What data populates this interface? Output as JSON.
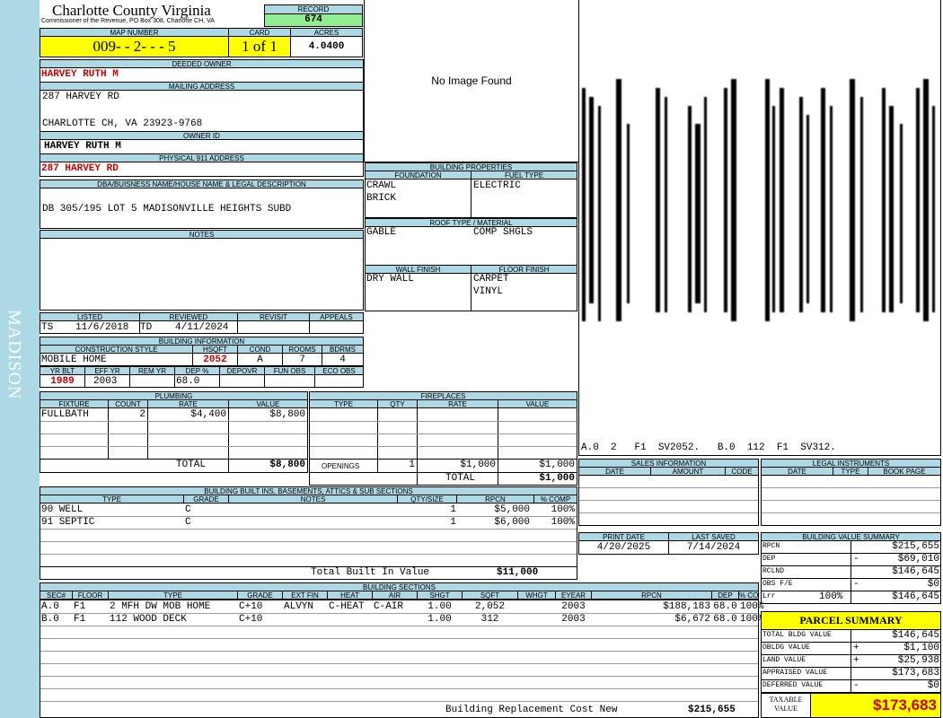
{
  "sidebar": {
    "text": "MADISON"
  },
  "header": {
    "county": "Charlotte County Virginia",
    "office": "Commissioner of the Revenue, PO Box 308, Charlotte CH, VA",
    "record_label": "RECORD",
    "record": "674",
    "map_label": "MAP NUMBER",
    "map_number": "009- - 2- - - 5",
    "card_label": "CARD",
    "card": "1 of 1",
    "acres_label": "ACRES",
    "acres": "4.0400"
  },
  "owner": {
    "deeded_label": "DEEDED OWNER",
    "deeded": "HARVEY RUTH M",
    "mailing_label": "MAILING ADDRESS",
    "mail1": "287 HARVEY RD",
    "mail2": "CHARLOTTE CH, VA 23923-9768",
    "ownerid_label": "OWNER ID",
    "ownerid": "HARVEY RUTH M",
    "phys_label": "PHYSICAL 911 ADDRESS",
    "phys": "287 HARVEY RD",
    "legal_label": "DBA/BUISNESS NAME/HOUSE NAME & LEGAL DESCRIPTION",
    "legal": "DB 305/195 LOT 5 MADISONVILLE HEIGHTS SUBD",
    "notes_label": "NOTES"
  },
  "image": {
    "text": "No Image Found"
  },
  "building_props": {
    "title": "BUILDING PROPERTIES",
    "foundation_label": "FOUNDATION",
    "fuel_label": "FUEL TYPE",
    "foundation1": "CRAWL",
    "foundation2": "BRICK",
    "fuel": "ELECTRIC",
    "roof_label": "ROOF TYPE / MATERIAL",
    "roof_type": "GABLE",
    "roof_mat": "COMP SHGLS",
    "wall_label": "WALL FINISH",
    "floor_label": "FLOOR FINISH",
    "wall": "DRY WALL",
    "floor1": "CARPET",
    "floor2": "VINYL"
  },
  "sketch": {
    "caption": "A.0  2   F1  SV2052.   B.0  112  F1  SV312."
  },
  "listing": {
    "listed_label": "LISTED",
    "reviewed_label": "REVIEWED",
    "revisit_label": "REVISIT",
    "appeals_label": "APPEALS",
    "listed_by": "TS",
    "listed_date": "11/6/2018",
    "reviewed_by": "TD",
    "reviewed_date": "4/11/2024"
  },
  "building_info": {
    "title": "BUILDING INFORMATION",
    "style_label": "CONSTRUCTION STYLE",
    "hsqft_label": "HSQFT",
    "cond_label": "COND",
    "rooms_label": "ROOMS",
    "bdrms_label": "BDRMS",
    "style": "MOBILE HOME",
    "hsqft": "2052",
    "cond": "A",
    "rooms": "7",
    "bdrms": "4",
    "yrblt_label": "YR BLT",
    "effyr_label": "EFF YR",
    "remyr_label": "REM YR",
    "dep_label": "DEP %",
    "depovr_label": "DEPOVR",
    "funobs_label": "FUN OBS",
    "ecoobs_label": "ECO OBS",
    "yrblt": "1989",
    "effyr": "2003",
    "dep": "68.0"
  },
  "plumbing": {
    "title": "PLUMBING",
    "h_fixture": "FIXTURE",
    "h_count": "COUNT",
    "h_rate": "RATE",
    "h_value": "VALUE",
    "fixture": "FULLBATH",
    "count": "2",
    "rate": "$4,400",
    "value": "$8,800",
    "total_label": "TOTAL",
    "total": "$8,800"
  },
  "fireplaces": {
    "title": "FIREPLACES",
    "h_type": "TYPE",
    "h_qty": "QTY",
    "h_rate": "RATE",
    "h_value": "VALUE",
    "openings_label": "OPENINGS",
    "qty": "1",
    "rate": "$1,000",
    "value": "$1,000",
    "total_label": "TOTAL",
    "total": "$1,000"
  },
  "builtins": {
    "title": "BUILDING BUILT INS, BASEMENTS, ATTICS & SUB SECTIONS",
    "h_type": "TYPE",
    "h_grade": "GRADE",
    "h_notes": "NOTES",
    "h_qty": "QTY/SIZE",
    "h_rpcn": "RPCN",
    "h_comp": "% COMP",
    "rows": [
      {
        "type": "90 WELL",
        "grade": "C",
        "qty": "1",
        "rpcn": "$5,000",
        "comp": "100%"
      },
      {
        "type": "91 SEPTIC",
        "grade": "C",
        "qty": "1",
        "rpcn": "$6,000",
        "comp": "100%"
      }
    ],
    "total_label": "Total Built In Value",
    "total": "$11,000"
  },
  "sales": {
    "title": "SALES INFORMATION",
    "h_date": "DATE",
    "h_amount": "AMOUNT",
    "h_code": "CODE"
  },
  "legal_inst": {
    "title": "LEGAL INSTRUMENTS",
    "h_date": "DATE",
    "h_type": "TYPE",
    "h_book": "BOOK PAGE"
  },
  "dates": {
    "print_label": "PRINT DATE",
    "saved_label": "LAST SAVED",
    "print": "4/20/2025",
    "saved": "7/14/2024"
  },
  "value_summary": {
    "title": "BUILDING VALUE SUMMARY",
    "rows": [
      {
        "label": "RPCN",
        "pct": "",
        "sign": "",
        "value": "$215,655"
      },
      {
        "label": "DEP",
        "pct": "",
        "sign": "-",
        "value": "$69,010"
      },
      {
        "label": "RCLND",
        "pct": "",
        "sign": "",
        "value": "$146,645"
      },
      {
        "label": "OBS F/E",
        "pct": "",
        "sign": "-",
        "value": "$0"
      },
      {
        "label": "Lrr",
        "pct": "100%",
        "sign": "",
        "value": "$146,645"
      }
    ]
  },
  "sections": {
    "title": "BUILDING SECTIONS",
    "headers": [
      "SEC#",
      "FLOOR",
      "TYPE",
      "GRADE",
      "EXT FIN",
      "HEAT",
      "AIR",
      "SHGT",
      "SQFT",
      "WHGT",
      "EYEAR",
      "RPCN",
      "DEP",
      "% COMP"
    ],
    "rows": [
      {
        "sec": "A.0",
        "floor": "F1",
        "type": "2 MFH DW MOB HOME",
        "grade": "C+10",
        "ext": "ALVYN",
        "heat": "C-HEAT",
        "air": "C-AIR",
        "shgt": "1.00",
        "sqft": "2,052",
        "whgt": "",
        "eyear": "2003",
        "rpcn": "$188,183",
        "dep": "68.0",
        "comp": "100%"
      },
      {
        "sec": "B.0",
        "floor": "F1",
        "type": "112 WOOD DECK",
        "grade": "C+10",
        "ext": "",
        "heat": "",
        "air": "",
        "shgt": "1.00",
        "sqft": "312",
        "whgt": "",
        "eyear": "2003",
        "rpcn": "$6,672",
        "dep": "68.0",
        "comp": "100%"
      }
    ],
    "replacement_label": "Building Replacement Cost New",
    "replacement": "$215,655"
  },
  "parcel": {
    "title": "PARCEL SUMMARY",
    "rows": [
      {
        "label": "TOTAL BLDG VALUE",
        "sign": "",
        "value": "$146,645"
      },
      {
        "label": "OBLDG VALUE",
        "sign": "+",
        "value": "$1,100"
      },
      {
        "label": "LAND VALUE",
        "sign": "+",
        "value": "$25,938"
      },
      {
        "label": "APPRAISED VALUE",
        "sign": "",
        "value": "$173,683"
      },
      {
        "label": "DEFERRED VALUE",
        "sign": "-",
        "value": "$0"
      }
    ],
    "taxable_label1": "TAXABLE",
    "taxable_label2": "VALUE",
    "taxable": "$173,683"
  },
  "colors": {
    "header_blue": "#add8e6",
    "highlight_yellow": "#ffff00",
    "record_green": "#90ee90",
    "red": "#cc0000"
  }
}
